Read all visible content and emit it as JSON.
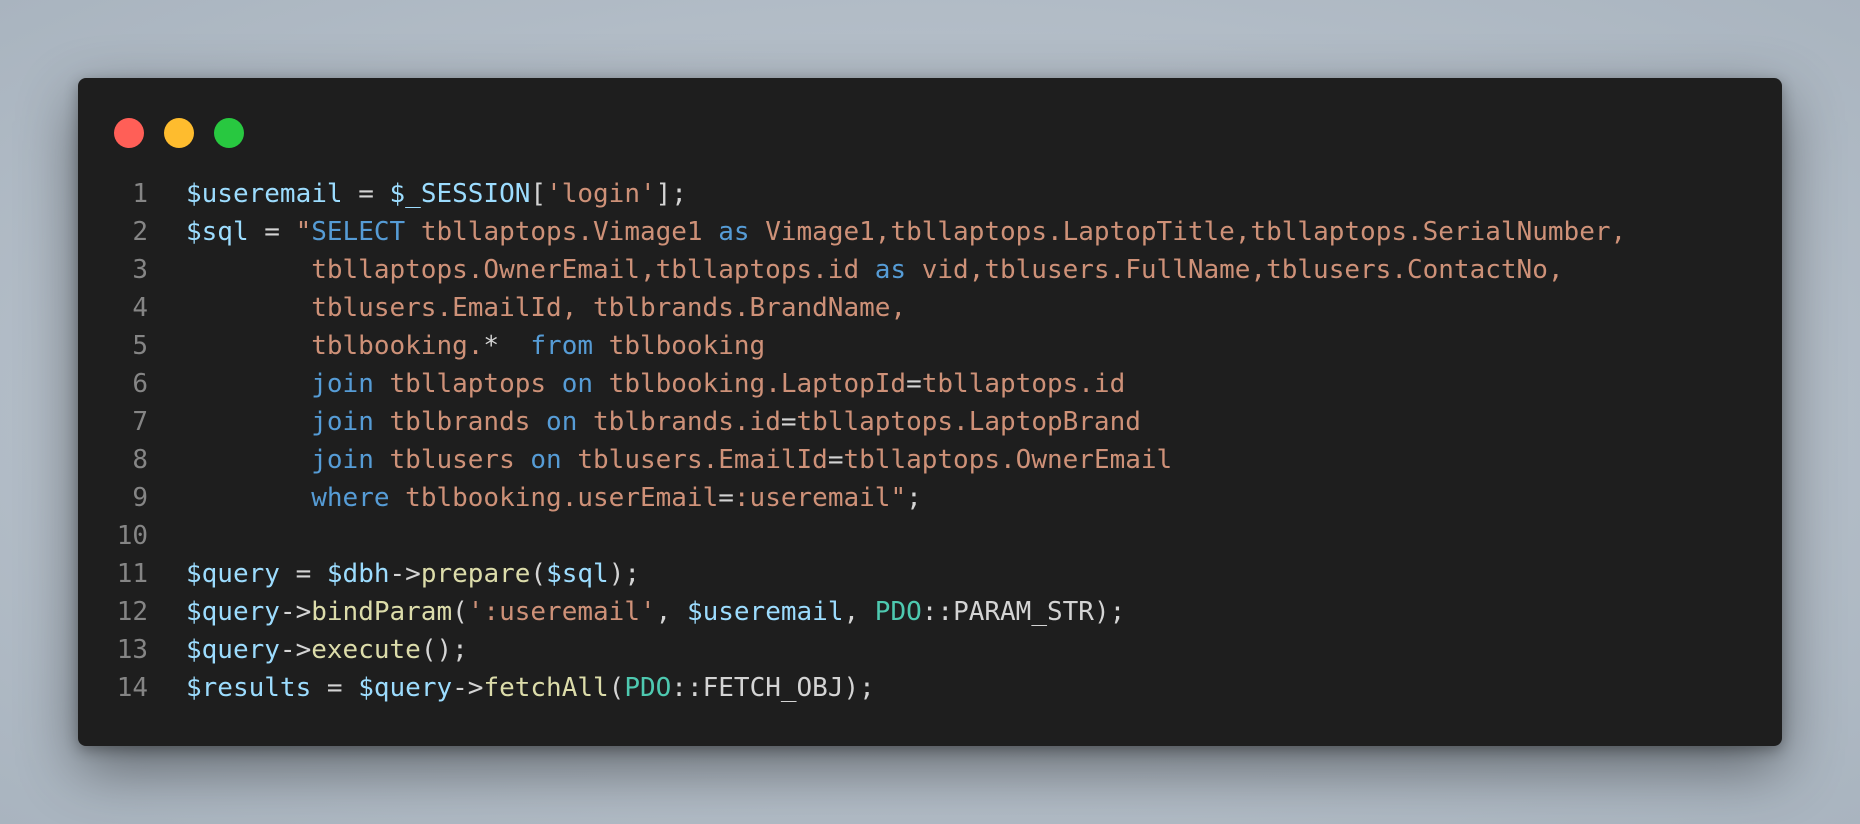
{
  "window": {
    "controls": [
      {
        "name": "close-dot",
        "color": "#ff5f57"
      },
      {
        "name": "minimize-dot",
        "color": "#febc2e"
      },
      {
        "name": "maximize-dot",
        "color": "#28c840"
      }
    ]
  },
  "colors": {
    "background": "#1e1e1e",
    "variable": "#9cdcfe",
    "string": "#ce9178",
    "keyword": "#569cd6",
    "function": "#dcdcaa",
    "class": "#4ec9b0",
    "line_number": "#858585"
  },
  "code": {
    "lines": [
      {
        "n": "1",
        "tokens": [
          {
            "t": "$useremail",
            "c": "var"
          },
          {
            "t": " = ",
            "c": "op"
          },
          {
            "t": "$_SESSION",
            "c": "var"
          },
          {
            "t": "[",
            "c": "op"
          },
          {
            "t": "'login'",
            "c": "str"
          },
          {
            "t": "];",
            "c": "op"
          }
        ]
      },
      {
        "n": "2",
        "tokens": [
          {
            "t": "$sql",
            "c": "var"
          },
          {
            "t": " = ",
            "c": "op"
          },
          {
            "t": "\"",
            "c": "str"
          },
          {
            "t": "SELECT",
            "c": "kw"
          },
          {
            "t": " tbllaptops.Vimage1 ",
            "c": "str"
          },
          {
            "t": "as",
            "c": "kw"
          },
          {
            "t": " Vimage1,tbllaptops.LaptopTitle,tbllaptops.SerialNumber,",
            "c": "str"
          }
        ]
      },
      {
        "n": "3",
        "tokens": [
          {
            "t": "        tbllaptops.OwnerEmail,tbllaptops.id ",
            "c": "str"
          },
          {
            "t": "as",
            "c": "kw"
          },
          {
            "t": " vid,tblusers.FullName,tblusers.ContactNo,",
            "c": "str"
          }
        ]
      },
      {
        "n": "4",
        "tokens": [
          {
            "t": "        tblusers.EmailId, tblbrands.BrandName,",
            "c": "str"
          }
        ]
      },
      {
        "n": "5",
        "tokens": [
          {
            "t": "        tblbooking.",
            "c": "str"
          },
          {
            "t": "*",
            "c": "op"
          },
          {
            "t": "  ",
            "c": "str"
          },
          {
            "t": "from",
            "c": "kw"
          },
          {
            "t": " tblbooking",
            "c": "str"
          }
        ]
      },
      {
        "n": "6",
        "tokens": [
          {
            "t": "        ",
            "c": "str"
          },
          {
            "t": "join",
            "c": "kw"
          },
          {
            "t": " tbllaptops ",
            "c": "str"
          },
          {
            "t": "on",
            "c": "kw"
          },
          {
            "t": " tblbooking.LaptopId",
            "c": "str"
          },
          {
            "t": "=",
            "c": "op"
          },
          {
            "t": "tbllaptops.id",
            "c": "str"
          }
        ]
      },
      {
        "n": "7",
        "tokens": [
          {
            "t": "        ",
            "c": "str"
          },
          {
            "t": "join",
            "c": "kw"
          },
          {
            "t": " tblbrands ",
            "c": "str"
          },
          {
            "t": "on",
            "c": "kw"
          },
          {
            "t": " tblbrands.id",
            "c": "str"
          },
          {
            "t": "=",
            "c": "op"
          },
          {
            "t": "tbllaptops.LaptopBrand",
            "c": "str"
          }
        ]
      },
      {
        "n": "8",
        "tokens": [
          {
            "t": "        ",
            "c": "str"
          },
          {
            "t": "join",
            "c": "kw"
          },
          {
            "t": " tblusers ",
            "c": "str"
          },
          {
            "t": "on",
            "c": "kw"
          },
          {
            "t": " tblusers.EmailId",
            "c": "str"
          },
          {
            "t": "=",
            "c": "op"
          },
          {
            "t": "tbllaptops.OwnerEmail",
            "c": "str"
          }
        ]
      },
      {
        "n": "9",
        "tokens": [
          {
            "t": "        ",
            "c": "str"
          },
          {
            "t": "where",
            "c": "kw"
          },
          {
            "t": " tblbooking.userEmail",
            "c": "str"
          },
          {
            "t": "=",
            "c": "op"
          },
          {
            "t": ":useremail\"",
            "c": "str"
          },
          {
            "t": ";",
            "c": "op"
          }
        ]
      },
      {
        "n": "10",
        "tokens": []
      },
      {
        "n": "11",
        "tokens": [
          {
            "t": "$query",
            "c": "var"
          },
          {
            "t": " = ",
            "c": "op"
          },
          {
            "t": "$dbh",
            "c": "var"
          },
          {
            "t": "->",
            "c": "op"
          },
          {
            "t": "prepare",
            "c": "fn"
          },
          {
            "t": "(",
            "c": "op"
          },
          {
            "t": "$sql",
            "c": "var"
          },
          {
            "t": ");",
            "c": "op"
          }
        ]
      },
      {
        "n": "12",
        "tokens": [
          {
            "t": "$query",
            "c": "var"
          },
          {
            "t": "->",
            "c": "op"
          },
          {
            "t": "bindParam",
            "c": "fn"
          },
          {
            "t": "(",
            "c": "op"
          },
          {
            "t": "':useremail'",
            "c": "str"
          },
          {
            "t": ", ",
            "c": "op"
          },
          {
            "t": "$useremail",
            "c": "var"
          },
          {
            "t": ", ",
            "c": "op"
          },
          {
            "t": "PDO",
            "c": "cls"
          },
          {
            "t": "::PARAM_STR);",
            "c": "op"
          }
        ]
      },
      {
        "n": "13",
        "tokens": [
          {
            "t": "$query",
            "c": "var"
          },
          {
            "t": "->",
            "c": "op"
          },
          {
            "t": "execute",
            "c": "fn"
          },
          {
            "t": "();",
            "c": "op"
          }
        ]
      },
      {
        "n": "14",
        "tokens": [
          {
            "t": "$results",
            "c": "var"
          },
          {
            "t": " = ",
            "c": "op"
          },
          {
            "t": "$query",
            "c": "var"
          },
          {
            "t": "->",
            "c": "op"
          },
          {
            "t": "fetchAll",
            "c": "fn"
          },
          {
            "t": "(",
            "c": "op"
          },
          {
            "t": "PDO",
            "c": "cls"
          },
          {
            "t": "::FETCH_OBJ);",
            "c": "op"
          }
        ]
      }
    ]
  }
}
